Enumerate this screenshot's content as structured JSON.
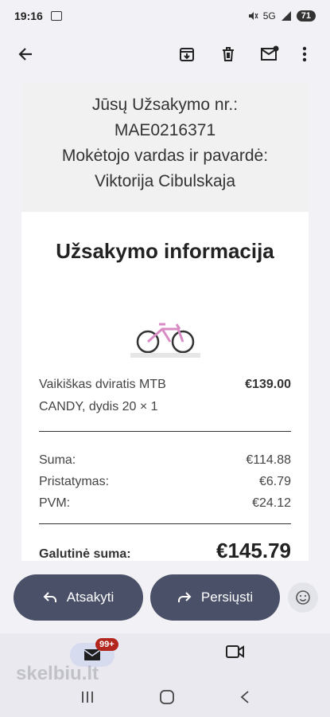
{
  "status": {
    "time": "19:16",
    "signal_text": "5G",
    "battery": "71"
  },
  "email": {
    "header_lines": [
      "Jūsų Užsakymo nr.:",
      "MAE0216371",
      "Mokėtojo vardas ir pavardė:",
      "Viktorija Cibulskaja"
    ],
    "section_title": "Užsakymo informacija",
    "product": {
      "name": "Vaikiškas dviratis MTB CANDY, dydis 20 × 1",
      "price": "€139.00"
    },
    "summary": [
      {
        "label": "Suma:",
        "value": "€114.88"
      },
      {
        "label": "Pristatymas:",
        "value": "€6.79"
      },
      {
        "label": "PVM:",
        "value": "€24.12"
      }
    ],
    "total": {
      "label": "Galutinė suma:",
      "value": "€145.79"
    }
  },
  "actions": {
    "reply_label": "Atsakyti",
    "forward_label": "Persiųsti"
  },
  "bottom_nav": {
    "badge": "99+"
  },
  "watermark": "skelbiu.lt",
  "icons": [
    "back-arrow-icon",
    "archive-icon",
    "delete-icon",
    "mark-unread-icon",
    "more-vert-icon",
    "reply-icon",
    "forward-icon",
    "emoji-icon",
    "mail-icon",
    "video-icon",
    "recents-icon",
    "home-icon",
    "back-icon"
  ]
}
